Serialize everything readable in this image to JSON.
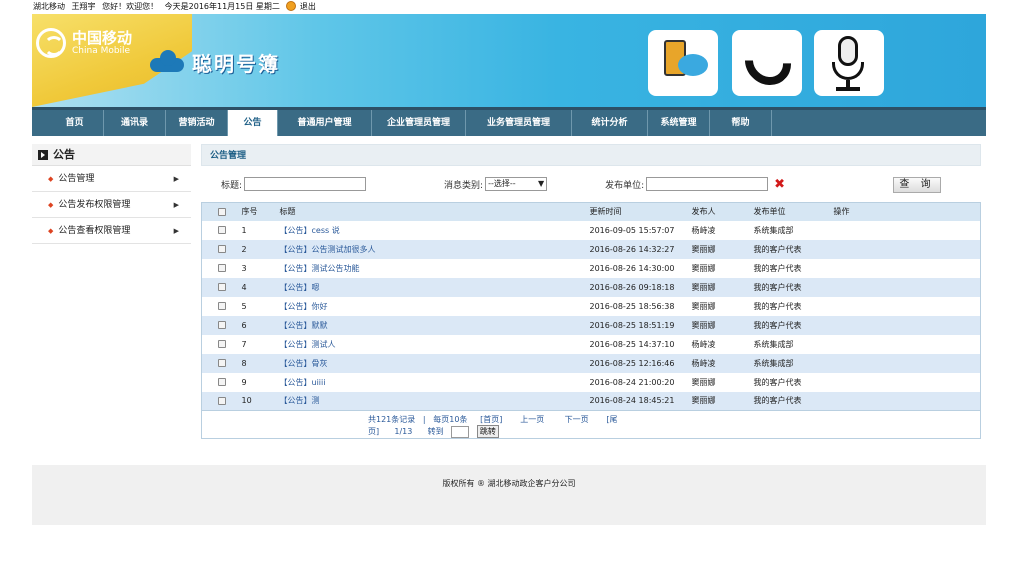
{
  "topbar": {
    "region": "湖北移动",
    "user": "王翔宇",
    "greeting": "您好！欢迎您！",
    "date": "今天是2016年11月15日 星期二",
    "logout": "退出"
  },
  "banner": {
    "logo_cn": "中国移动",
    "logo_en": "China Mobile",
    "slogan": "聪明号簿"
  },
  "nav": {
    "items": [
      {
        "label": "首页"
      },
      {
        "label": "通讯录"
      },
      {
        "label": "营销活动"
      },
      {
        "label": "公告"
      },
      {
        "label": "普通用户管理"
      },
      {
        "label": "企业管理员管理"
      },
      {
        "label": "业务管理员管理"
      },
      {
        "label": "统计分析"
      },
      {
        "label": "系统管理"
      },
      {
        "label": "帮助"
      }
    ],
    "active": "公告"
  },
  "sidebar": {
    "title": "公告",
    "items": [
      {
        "label": "公告管理"
      },
      {
        "label": "公告发布权限管理"
      },
      {
        "label": "公告查看权限管理"
      }
    ]
  },
  "main": {
    "title": "公告管理",
    "filter": {
      "title_label": "标题:",
      "category_label": "消息类别:",
      "category_value": "--选择--",
      "unit_label": "发布单位:",
      "query_button": "查 询"
    },
    "table": {
      "headers": [
        "序号",
        "标题",
        "更新时间",
        "发布人",
        "发布单位",
        "操作"
      ],
      "rows": [
        {
          "no": "1",
          "title": "【公告】cess 说",
          "time": "2016-09-05 15:57:07",
          "publisher": "杨峙凌",
          "unit": "系统集成部"
        },
        {
          "no": "2",
          "title": "【公告】公告测试加很多人",
          "time": "2016-08-26 14:32:27",
          "publisher": "窦丽娜",
          "unit": "我的客户代表"
        },
        {
          "no": "3",
          "title": "【公告】测试公告功能",
          "time": "2016-08-26 14:30:00",
          "publisher": "窦丽娜",
          "unit": "我的客户代表"
        },
        {
          "no": "4",
          "title": "【公告】嗯",
          "time": "2016-08-26 09:18:18",
          "publisher": "窦丽娜",
          "unit": "我的客户代表"
        },
        {
          "no": "5",
          "title": "【公告】你好",
          "time": "2016-08-25 18:56:38",
          "publisher": "窦丽娜",
          "unit": "我的客户代表"
        },
        {
          "no": "6",
          "title": "【公告】默默",
          "time": "2016-08-25 18:51:19",
          "publisher": "窦丽娜",
          "unit": "我的客户代表"
        },
        {
          "no": "7",
          "title": "【公告】测试人",
          "time": "2016-08-25 14:37:10",
          "publisher": "杨峙凌",
          "unit": "系统集成部"
        },
        {
          "no": "8",
          "title": "【公告】骨灰",
          "time": "2016-08-25 12:16:46",
          "publisher": "杨峙凌",
          "unit": "系统集成部"
        },
        {
          "no": "9",
          "title": "【公告】uiiii",
          "time": "2016-08-24 21:00:20",
          "publisher": "窦丽娜",
          "unit": "我的客户代表"
        },
        {
          "no": "10",
          "title": "【公告】测",
          "time": "2016-08-24 18:45:21",
          "publisher": "窦丽娜",
          "unit": "我的客户代表"
        }
      ]
    },
    "pager": {
      "total": "共121条记录",
      "sep": "|",
      "per_page": "每页10条",
      "first": "[首页]",
      "prev": "上一页",
      "next": "下一页",
      "last_a": "[尾",
      "last_b": "页]",
      "page": "1/13",
      "goto": "转到",
      "jump": "跳转"
    }
  },
  "footer": {
    "text": "版权所有 ® 湖北移动政企客户分公司"
  },
  "colors": {
    "nav_bg": "#3a6b85",
    "row_alt": "#dbe8f6",
    "header_bg": "#d6e6f3",
    "link": "#2b5a9a",
    "clear_icon": "#d21a1a"
  }
}
